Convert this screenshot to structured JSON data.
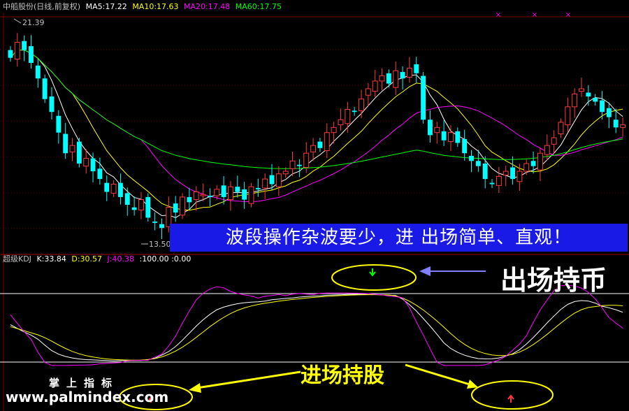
{
  "header": {
    "stock_name": "中船股份",
    "period_label": "(日线,前复权)",
    "ma5": "MA5:17.22",
    "ma10": "MA10:17.63",
    "ma20": "MA20:17.48",
    "ma60": "MA60:17.75"
  },
  "price_marks": {
    "high": "21.39",
    "low": "13.50"
  },
  "banner": {
    "text": "波段操作杂波要少，进   出场简单、直观！"
  },
  "kdj_header": {
    "name": "超级KDJ",
    "k": "K:33.84",
    "d": "D:30.57",
    "j": "J:40.38",
    "ref1": ":100.00",
    "ref2": ":0.00"
  },
  "annotations": {
    "exit": "出场持币",
    "entry": "进场持股"
  },
  "watermark": {
    "line1": "掌上指标",
    "line2": "www.palmindex.com"
  },
  "colors": {
    "background": "#000000",
    "up": "#ff3b3b",
    "down": "#00ffff",
    "ma5": "#ffffff",
    "ma10": "#ffff00",
    "ma20": "#ff00ff",
    "ma60": "#00ff00",
    "banner": "#1a1ae6",
    "ellipse": "#ffff00",
    "arrow": "#8080ff"
  },
  "chart_data": [
    {
      "type": "candlestick",
      "title": "中船股份(日线,前复权)",
      "series": [
        {
          "name": "MA5",
          "last": 17.22
        },
        {
          "name": "MA10",
          "last": 17.63
        },
        {
          "name": "MA20",
          "last": 17.48
        },
        {
          "name": "MA60",
          "last": 17.75
        }
      ],
      "high_mark": 21.39,
      "low_mark": 13.5,
      "close": [
        20.3,
        20.9,
        20.6,
        20.1,
        19.5,
        18.7,
        18.2,
        17.4,
        16.6,
        16.9,
        16.2,
        16.4,
        15.9,
        15.6,
        15.1,
        15.4,
        14.9,
        14.6,
        14.4,
        14.8,
        14.1,
        13.9,
        13.7,
        14.5,
        14.3,
        14.9,
        14.7,
        15.1,
        15.0,
        14.9,
        15.2,
        14.9,
        15.3,
        15.1,
        14.8,
        15.3,
        15.2,
        15.6,
        15.4,
        15.8,
        15.9,
        16.3,
        16.1,
        16.6,
        16.9,
        16.8,
        17.4,
        17.6,
        17.9,
        18.3,
        18.2,
        18.7,
        19.1,
        19.4,
        19.6,
        19.3,
        19.8,
        19.5,
        19.9,
        19.7,
        17.9,
        17.3,
        17.6,
        17.1,
        17.4,
        17.0,
        16.6,
        16.3,
        16.1,
        15.6,
        15.4,
        15.7,
        15.9,
        15.6,
        15.9,
        16.2,
        16.1,
        16.6,
        16.9,
        17.2,
        17.8,
        18.4,
        18.9,
        19.1,
        18.8,
        18.6,
        18.2,
        18.0,
        17.6,
        17.7
      ]
    },
    {
      "type": "line",
      "title": "超级KDJ",
      "series": [
        {
          "name": "K",
          "last": 33.84
        },
        {
          "name": "D",
          "last": 30.57
        },
        {
          "name": "J",
          "last": 40.38
        }
      ],
      "reference_lines": [
        100,
        0
      ]
    }
  ]
}
